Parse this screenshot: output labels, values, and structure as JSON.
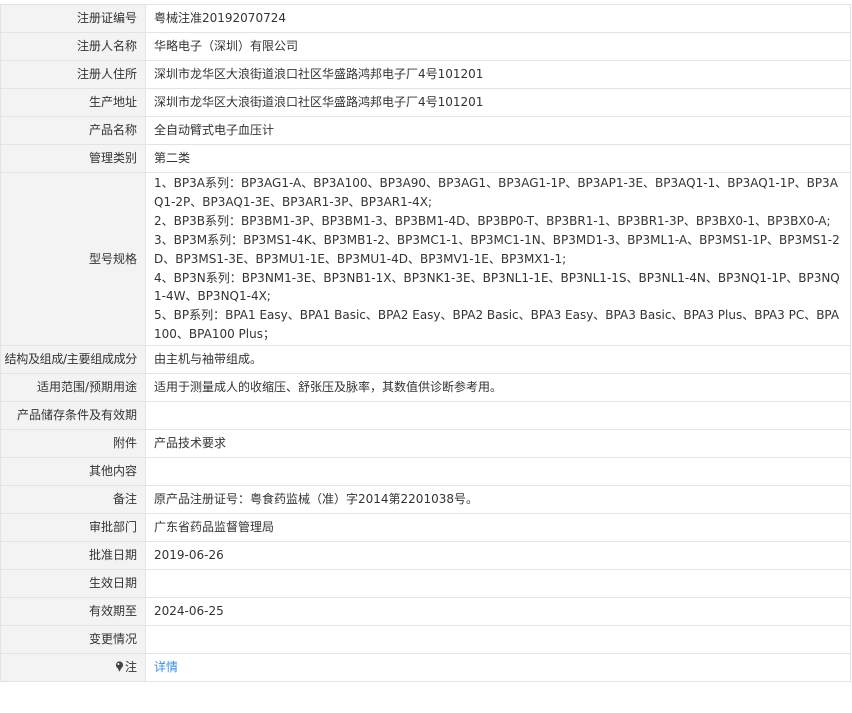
{
  "rows": {
    "reg_no": {
      "label": "注册证编号",
      "value": "粤械注准20192070724"
    },
    "registrant_name": {
      "label": "注册人名称",
      "value": "华略电子（深圳）有限公司"
    },
    "registrant_address": {
      "label": "注册人住所",
      "value": "深圳市龙华区大浪街道浪口社区华盛路鸿邦电子厂4号101201"
    },
    "production_address": {
      "label": "生产地址",
      "value": "深圳市龙华区大浪街道浪口社区华盛路鸿邦电子厂4号101201"
    },
    "product_name": {
      "label": "产品名称",
      "value": "全自动臂式电子血压计"
    },
    "management_class": {
      "label": "管理类别",
      "value": "第二类"
    },
    "model_spec": {
      "label": "型号规格",
      "lines": [
        "1、BP3A系列：BP3AG1-A、BP3A100、BP3A90、BP3AG1、BP3AG1-1P、BP3AP1-3E、BP3AQ1-1、BP3AQ1-1P、BP3AQ1-2P、BP3AQ1-3E、BP3AR1-3P、BP3AR1-4X;",
        "2、BP3B系列：BP3BM1-3P、BP3BM1-3、BP3BM1-4D、BP3BP0-T、BP3BR1-1、BP3BR1-3P、BP3BX0-1、BP3BX0-A;",
        "3、BP3M系列：BP3MS1-4K、BP3MB1-2、BP3MC1-1、BP3MC1-1N、BP3MD1-3、BP3ML1-A、BP3MS1-1P、BP3MS1-2D、BP3MS1-3E、BP3MU1-1E、BP3MU1-4D、BP3MV1-1E、BP3MX1-1;",
        "4、BP3N系列：BP3NM1-3E、BP3NB1-1X、BP3NK1-3E、BP3NL1-1E、BP3NL1-1S、BP3NL1-4N、BP3NQ1-1P、BP3NQ1-4W、BP3NQ1-4X;",
        "5、BP系列：BPA1 Easy、BPA1 Basic、BPA2 Easy、BPA2 Basic、BPA3 Easy、BPA3 Basic、BPA3 Plus、BPA3 PC、BPA100、BPA100 Plus；"
      ]
    },
    "structure": {
      "label": "结构及组成/主要组成成分",
      "value": "由主机与袖带组成。"
    },
    "scope": {
      "label": "适用范围/预期用途",
      "value": "适用于测量成人的收缩压、舒张压及脉率，其数值供诊断参考用。"
    },
    "storage": {
      "label": "产品储存条件及有效期",
      "value": ""
    },
    "attachment": {
      "label": "附件",
      "value": "产品技术要求"
    },
    "other": {
      "label": "其他内容",
      "value": ""
    },
    "remark": {
      "label": "备注",
      "value": "原产品注册证号：粤食药监械（准）字2014第2201038号。"
    },
    "approval_dept": {
      "label": "审批部门",
      "value": "广东省药品监督管理局"
    },
    "approval_date": {
      "label": "批准日期",
      "value": "2019-06-26"
    },
    "effective_date": {
      "label": "生效日期",
      "value": ""
    },
    "valid_until": {
      "label": "有效期至",
      "value": "2024-06-25"
    },
    "changes": {
      "label": "变更情况",
      "value": ""
    },
    "note": {
      "label": "注",
      "link": "详情",
      "icon": "pin-icon"
    }
  },
  "colors": {
    "label_bg": "#f3f3f3",
    "border": "#e3e3e3",
    "link": "#3a8ee6",
    "text": "#333333"
  }
}
